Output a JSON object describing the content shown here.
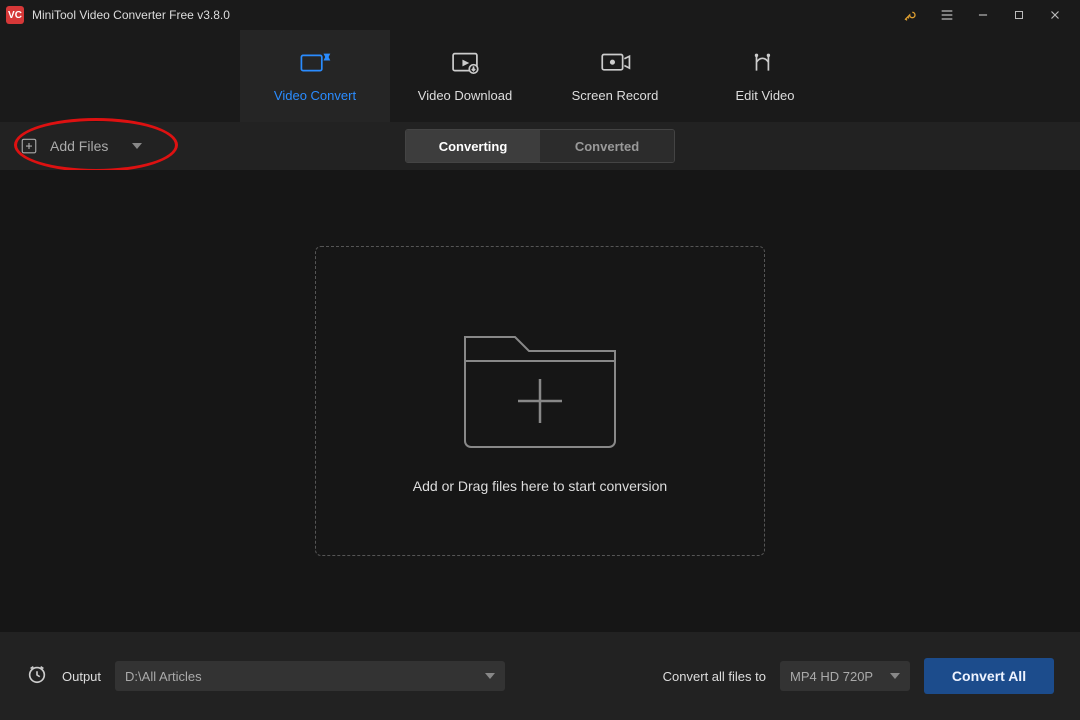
{
  "app": {
    "icon_text": "VC",
    "title": "MiniTool Video Converter Free v3.8.0"
  },
  "tabs": {
    "video_convert": "Video Convert",
    "video_download": "Video Download",
    "screen_record": "Screen Record",
    "edit_video": "Edit Video"
  },
  "toolbar": {
    "add_files": "Add Files",
    "converting": "Converting",
    "converted": "Converted"
  },
  "dropzone": {
    "hint": "Add or Drag files here to start conversion"
  },
  "footer": {
    "output_label": "Output",
    "output_path": "D:\\All Articles",
    "convert_all_label": "Convert all files to",
    "format": "MP4 HD 720P",
    "convert_all_btn": "Convert All"
  }
}
